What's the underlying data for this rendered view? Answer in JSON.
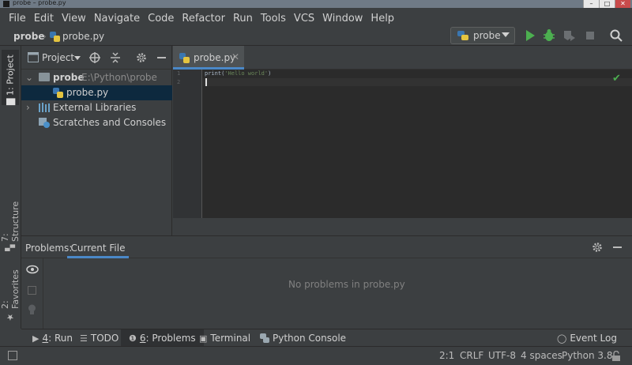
{
  "window": {
    "title": "probe – probe.py"
  },
  "menubar": {
    "items": [
      "File",
      "Edit",
      "View",
      "Navigate",
      "Code",
      "Refactor",
      "Run",
      "Tools",
      "VCS",
      "Window",
      "Help"
    ]
  },
  "navbar": {
    "project": "probe",
    "file": "probe.py",
    "run_config": "probe"
  },
  "left_stripe": {
    "project_tab": "1: Project",
    "structure_tab": "7: Structure",
    "favorites_tab": "2: Favorites"
  },
  "project_panel": {
    "title": "Project",
    "tree": [
      {
        "label": "probe",
        "path": "E:\\Python\\probe",
        "type": "folder",
        "expanded": true
      },
      {
        "label": "probe.py",
        "type": "file",
        "selected": true
      },
      {
        "label": "External Libraries",
        "type": "library",
        "expanded": false
      },
      {
        "label": "Scratches and Consoles",
        "type": "scratches"
      }
    ]
  },
  "editor": {
    "tab_label": "probe.py",
    "line_numbers": [
      "1",
      "2"
    ],
    "code_prefix": "print(",
    "code_string": "'Hello world'",
    "code_suffix": ")"
  },
  "problems_panel": {
    "title": "Problems:",
    "tab": "Current File",
    "empty_message": "No problems in probe.py"
  },
  "bottom_toolbar": {
    "run_key": "4",
    "run_label": ": Run",
    "todo": "TODO",
    "problems_key": "6",
    "problems_label": ": Problems",
    "terminal": "Terminal",
    "python_console": "Python Console",
    "event_log": "Event Log"
  },
  "statusbar": {
    "position": "2:1",
    "line_sep": "CRLF",
    "encoding": "UTF-8",
    "indent": "4 spaces",
    "interpreter": "Python 3.8"
  },
  "colors": {
    "accent": "#4a88c7",
    "run_green": "#4caf50",
    "selection": "#0d293e",
    "editor_bg": "#2b2b2b",
    "panel_bg": "#3c3f41"
  }
}
